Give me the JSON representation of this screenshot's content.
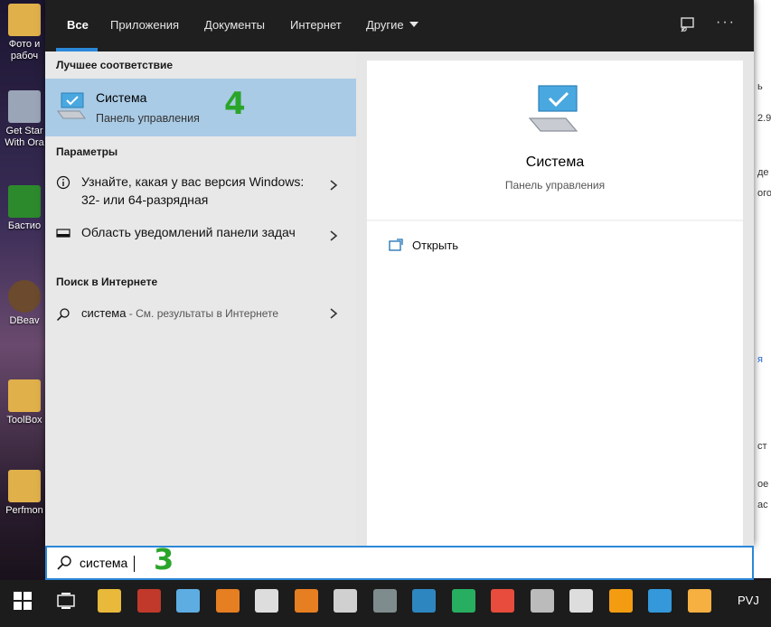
{
  "desktop": {
    "icons": [
      {
        "label": "Фото и\nрабоч",
        "color": "#e0b04a"
      },
      {
        "label": "Get Star\nWith Ora",
        "color": "#9aa5b8"
      },
      {
        "label": "Бастио",
        "color": "#2c8a2c"
      },
      {
        "label": "DBeav",
        "color": "#6b4a2e"
      },
      {
        "label": "ToolBox",
        "color": "#e0b04a"
      },
      {
        "label": "Perfmon",
        "color": "#e0b04a"
      }
    ]
  },
  "tabs": {
    "all": "Все",
    "apps": "Приложения",
    "docs": "Документы",
    "web": "Интернет",
    "other": "Другие"
  },
  "topbar_icons": {
    "feedback": "feedback-icon",
    "more": "···"
  },
  "left": {
    "best_match_title": "Лучшее соответствие",
    "best_match": {
      "name": "Система",
      "sub": "Панель управления",
      "icon": "computer-monitor-icon"
    },
    "params_title": "Параметры",
    "params": [
      {
        "text": "Узнайте, какая у вас версия Windows: 32- или 64-разрядная",
        "icon": "info-icon"
      },
      {
        "text": "Область уведомлений панели задач",
        "icon": "taskbar-icon"
      }
    ],
    "web_title": "Поиск в Интернете",
    "web_result": {
      "query": "система",
      "suffix": " - См. результаты в Интернете",
      "icon": "search-icon"
    }
  },
  "right": {
    "title": "Система",
    "subtitle": "Панель управления",
    "open_label": "Открыть"
  },
  "search": {
    "value": "система"
  },
  "annotations": {
    "step_best": "4",
    "step_search": "3"
  },
  "taskbar": {
    "tray_text": "PVJ",
    "items": [
      {
        "name": "start-button",
        "color": "#ffffff"
      },
      {
        "name": "task-view-button",
        "color": "#ffffff"
      },
      {
        "name": "file-explorer",
        "color": "#e8b93a"
      },
      {
        "name": "paint-app",
        "color": "#c0392b"
      },
      {
        "name": "pen-app",
        "color": "#5dade2"
      },
      {
        "name": "paint-palette-app",
        "color": "#e67e22"
      },
      {
        "name": "obs-app",
        "color": "#dddddd"
      },
      {
        "name": "photo-app",
        "color": "#e67e22"
      },
      {
        "name": "gp-app",
        "color": "#d0d0d0"
      },
      {
        "name": "vpn-app",
        "color": "#7f8c8d"
      },
      {
        "name": "virtualbox-app",
        "color": "#2e86c1"
      },
      {
        "name": "chrome-app",
        "color": "#27ae60"
      },
      {
        "name": "xmind-app",
        "color": "#e74c3c"
      },
      {
        "name": "console-app",
        "color": "#bbbbbb"
      },
      {
        "name": "pgadmin-app",
        "color": "#dddddd"
      },
      {
        "name": "network-app",
        "color": "#f39c12"
      },
      {
        "name": "computer-app",
        "color": "#3498db"
      },
      {
        "name": "installer-app",
        "color": "#f5b041"
      }
    ]
  },
  "bg_app": {
    "lines": [
      "ь",
      "2.9",
      "де",
      "ого",
      "я",
      "ст",
      "ое",
      "ас"
    ]
  }
}
